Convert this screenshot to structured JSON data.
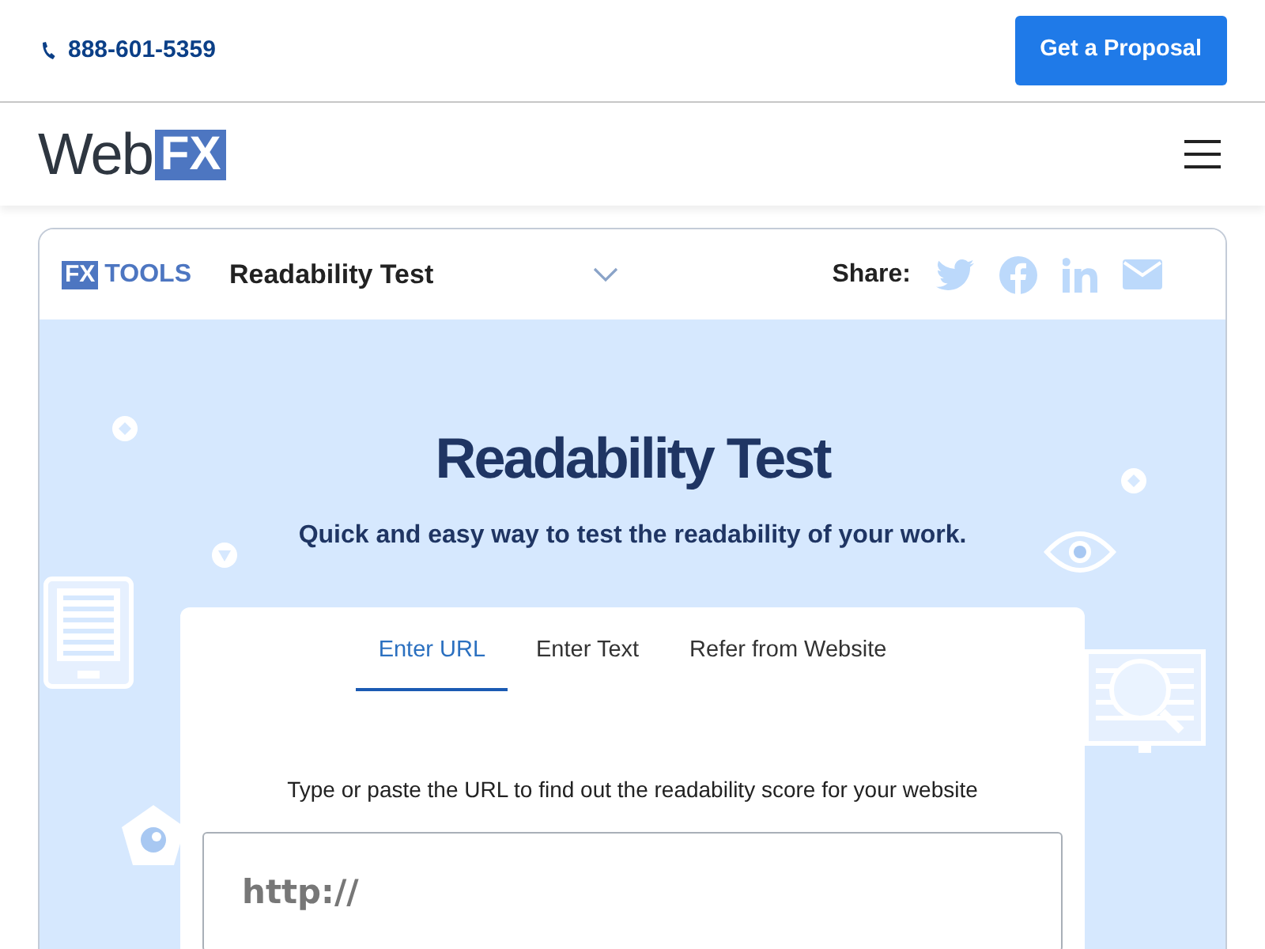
{
  "topbar": {
    "phone": "888-601-5359",
    "cta": "Get a Proposal"
  },
  "navbar": {
    "logo": {
      "word": "Web",
      "mark": "FX"
    }
  },
  "tool_header": {
    "badge": {
      "mark": "FX",
      "word": "TOOLS"
    },
    "tool_name": "Readability Test",
    "share_label": "Share:"
  },
  "hero": {
    "title": "Readability Test",
    "subtitle": "Quick and easy way to test the readability of your work."
  },
  "tabs": [
    {
      "label": "Enter URL",
      "selected": true
    },
    {
      "label": "Enter Text",
      "selected": false
    },
    {
      "label": "Refer from Website",
      "selected": false
    }
  ],
  "instruction": "Type or paste the URL to find out the readability score for your website",
  "url_field": {
    "placeholder": "http://"
  }
}
